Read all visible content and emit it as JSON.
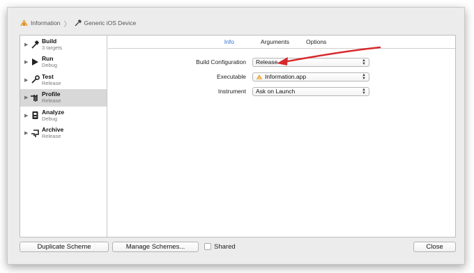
{
  "breadcrumb": {
    "scheme": "Information",
    "destination": "Generic iOS Device"
  },
  "sidebar": {
    "items": [
      {
        "name": "Build",
        "sub": "3 targets",
        "icon": "hammer-icon"
      },
      {
        "name": "Run",
        "sub": "Debug",
        "icon": "play-icon"
      },
      {
        "name": "Test",
        "sub": "Release",
        "icon": "wrench-icon"
      },
      {
        "name": "Profile",
        "sub": "Release",
        "icon": "tuning-fork-icon",
        "selected": true
      },
      {
        "name": "Analyze",
        "sub": "Debug",
        "icon": "analyze-icon"
      },
      {
        "name": "Archive",
        "sub": "Release",
        "icon": "archive-icon"
      }
    ]
  },
  "tabs": [
    "Info",
    "Arguments",
    "Options"
  ],
  "form": {
    "build_configuration": {
      "label": "Build Configuration",
      "value": "Release"
    },
    "executable": {
      "label": "Executable",
      "value": "Information.app"
    },
    "instrument": {
      "label": "Instrument",
      "value": "Ask on Launch"
    }
  },
  "footer": {
    "duplicate": "Duplicate Scheme",
    "manage": "Manage Schemes...",
    "shared": "Shared",
    "close": "Close"
  },
  "colors": {
    "accent_tab": "#2f6fd0",
    "annotation_arrow": "#d7282b",
    "selected_row": "#d8d8d8"
  }
}
